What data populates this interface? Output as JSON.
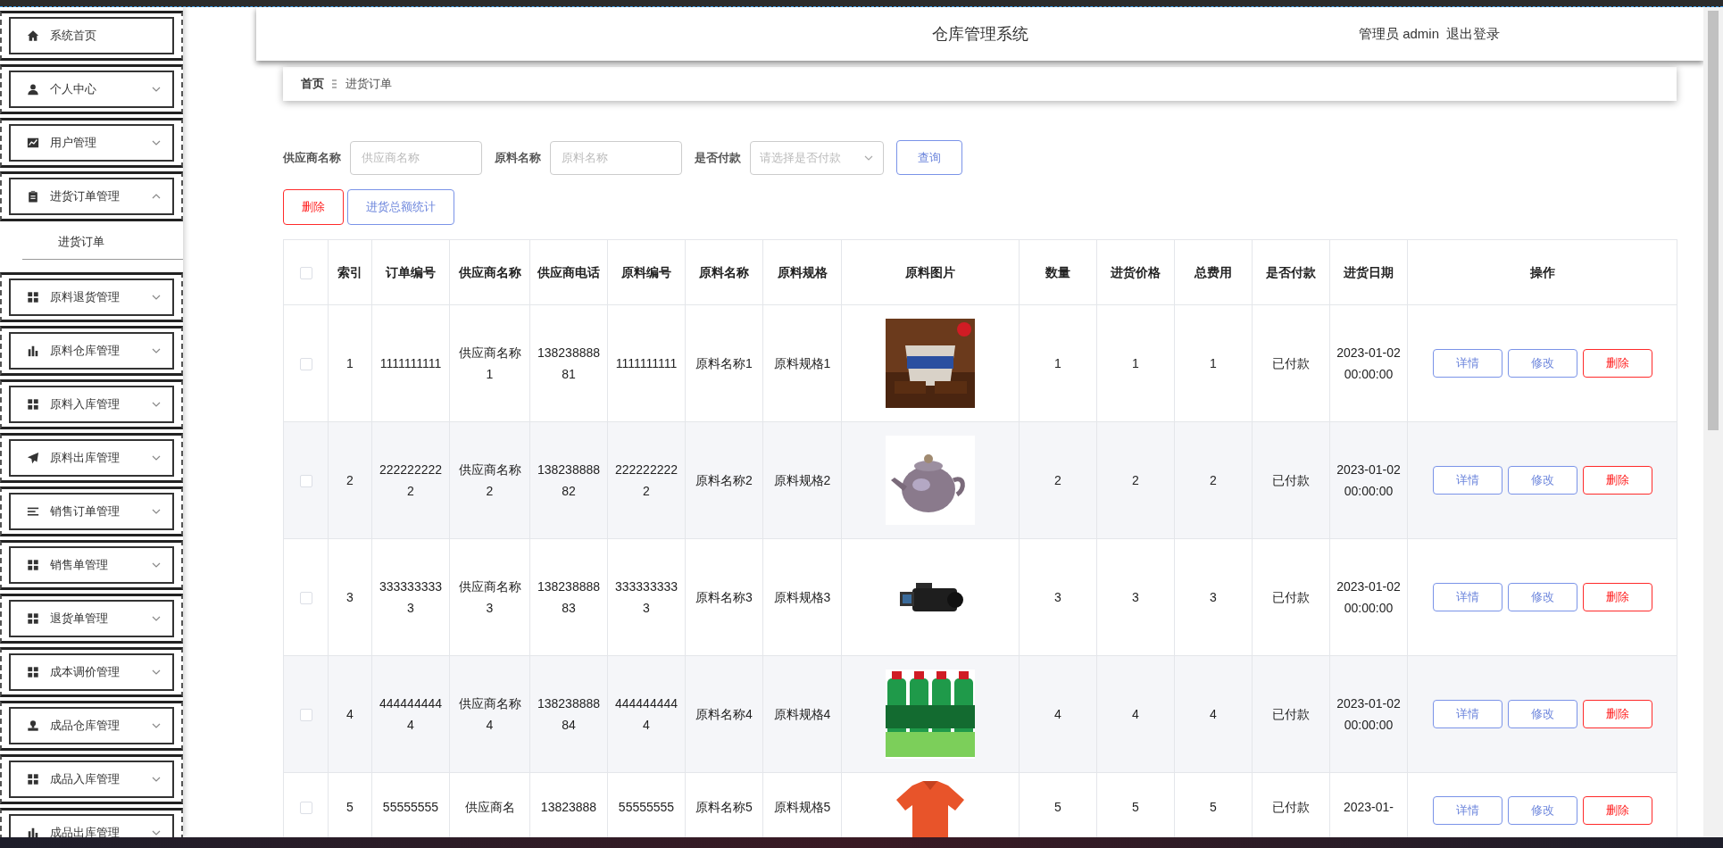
{
  "sidebar": {
    "items": [
      {
        "label": "系统首页",
        "expandable": false
      },
      {
        "label": "个人中心",
        "expandable": true,
        "expanded": false
      },
      {
        "label": "用户管理",
        "expandable": true,
        "expanded": false
      },
      {
        "label": "进货订单管理",
        "expandable": true,
        "expanded": true,
        "children": [
          {
            "label": "进货订单"
          }
        ]
      },
      {
        "label": "原料退货管理",
        "expandable": true,
        "expanded": false
      },
      {
        "label": "原料仓库管理",
        "expandable": true,
        "expanded": false
      },
      {
        "label": "原料入库管理",
        "expandable": true,
        "expanded": false
      },
      {
        "label": "原料出库管理",
        "expandable": true,
        "expanded": false
      },
      {
        "label": "销售订单管理",
        "expandable": true,
        "expanded": false
      },
      {
        "label": "销售单管理",
        "expandable": true,
        "expanded": false
      },
      {
        "label": "退货单管理",
        "expandable": true,
        "expanded": false
      },
      {
        "label": "成本调价管理",
        "expandable": true,
        "expanded": false
      },
      {
        "label": "成品仓库管理",
        "expandable": true,
        "expanded": false
      },
      {
        "label": "成品入库管理",
        "expandable": true,
        "expanded": false
      },
      {
        "label": "成品出库管理",
        "expandable": true,
        "expanded": false
      }
    ]
  },
  "header": {
    "title": "仓库管理系统",
    "user": "管理员 admin",
    "logout": "退出登录"
  },
  "breadcrumb": [
    "首页",
    "进货订单"
  ],
  "filters": [
    {
      "label": "供应商名称",
      "kind": "input",
      "placeholder": "供应商名称"
    },
    {
      "label": "原料名称",
      "kind": "input",
      "placeholder": "原料名称"
    },
    {
      "label": "是否付款",
      "kind": "select",
      "placeholder": "请选择是否付款"
    }
  ],
  "search_button": "查询",
  "actions": [
    {
      "label": "删除",
      "kind": "danger"
    },
    {
      "label": "进货总额统计",
      "kind": "primary"
    }
  ],
  "table": {
    "all_selected": false,
    "columns": [
      "索引",
      "订单编号",
      "供应商名称",
      "供应商电话",
      "原料编号",
      "原料名称",
      "原料规格",
      "原料图片",
      "数量",
      "进货价格",
      "总费用",
      "是否付款",
      "进货日期",
      "操作"
    ],
    "rows": [
      {
        "selected": false,
        "cells": [
          "1",
          "1111111111",
          "供应商名称1",
          "13823888881",
          "1111111111",
          "原料名称1",
          "原料规格1"
        ],
        "cells2": [
          "1",
          "1",
          "1",
          "已付款",
          "2023-01-02 00:00:00"
        ],
        "buttons": [
          "详情",
          "修改",
          "删除"
        ]
      },
      {
        "selected": false,
        "cells": [
          "2",
          "2222222222",
          "供应商名称2",
          "13823888882",
          "2222222222",
          "原料名称2",
          "原料规格2"
        ],
        "cells2": [
          "2",
          "2",
          "2",
          "已付款",
          "2023-01-02 00:00:00"
        ],
        "buttons": [
          "详情",
          "修改",
          "删除"
        ]
      },
      {
        "selected": false,
        "cells": [
          "3",
          "3333333333",
          "供应商名称3",
          "13823888883",
          "3333333333",
          "原料名称3",
          "原料规格3"
        ],
        "cells2": [
          "3",
          "3",
          "3",
          "已付款",
          "2023-01-02 00:00:00"
        ],
        "buttons": [
          "详情",
          "修改",
          "删除"
        ]
      },
      {
        "selected": false,
        "cells": [
          "4",
          "4444444444",
          "供应商名称4",
          "13823888884",
          "4444444444",
          "原料名称4",
          "原料规格4"
        ],
        "cells2": [
          "4",
          "4",
          "4",
          "已付款",
          "2023-01-02 00:00:00"
        ],
        "buttons": [
          "详情",
          "修改",
          "删除"
        ]
      },
      {
        "selected": false,
        "cells": [
          "5",
          "55555555",
          "供应商名",
          "13823888",
          "55555555",
          "原料名称5",
          "原料规格5"
        ],
        "cells2": [
          "5",
          "5",
          "5",
          "已付款",
          "2023-01-"
        ],
        "buttons": [
          "详情",
          "修改",
          "删除"
        ]
      }
    ]
  }
}
